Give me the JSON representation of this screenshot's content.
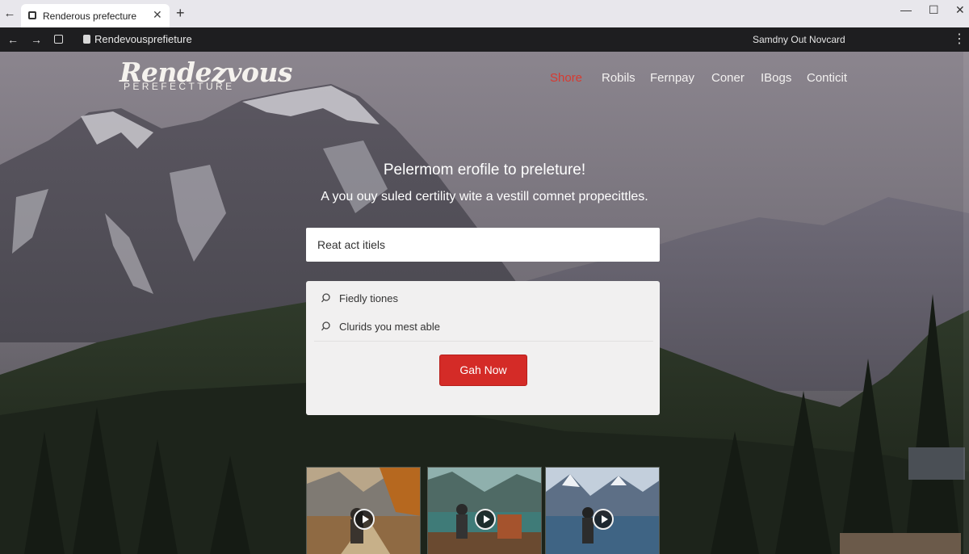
{
  "browser": {
    "tab_title": "Renderous prefecture",
    "url": "Rendevousprefieture",
    "account_text": "Samdny Out Novcard",
    "icons": [
      "back-icon",
      "forward-icon",
      "stop-icon",
      "lock-icon",
      "close-icon",
      "plus-icon",
      "minimize-icon",
      "maximize-icon",
      "menu-icon"
    ]
  },
  "site": {
    "logo_main": "Rendezvous",
    "logo_sub": "PEREFECTTURE",
    "nav": [
      "Shore",
      "Robils",
      "Fernpay",
      "Coner",
      "IBogs",
      "Conticit"
    ],
    "active_nav": "Shore",
    "accent_color": "#d42b27"
  },
  "hero": {
    "title": "Pelermom erofile to preleture!",
    "subtitle": "A you ouy suled certility wite a vestill comnet propecittles."
  },
  "search": {
    "value": "Reat act itiels"
  },
  "options": [
    {
      "icon": "chat-icon",
      "label": "Fiedly tiones"
    },
    {
      "icon": "chat-icon",
      "label": "Clurids you mest able"
    }
  ],
  "cta": {
    "label": "Gah Now"
  },
  "thumbnails": [
    {
      "icon": "play-icon"
    },
    {
      "icon": "play-icon"
    },
    {
      "icon": "play-icon"
    }
  ]
}
